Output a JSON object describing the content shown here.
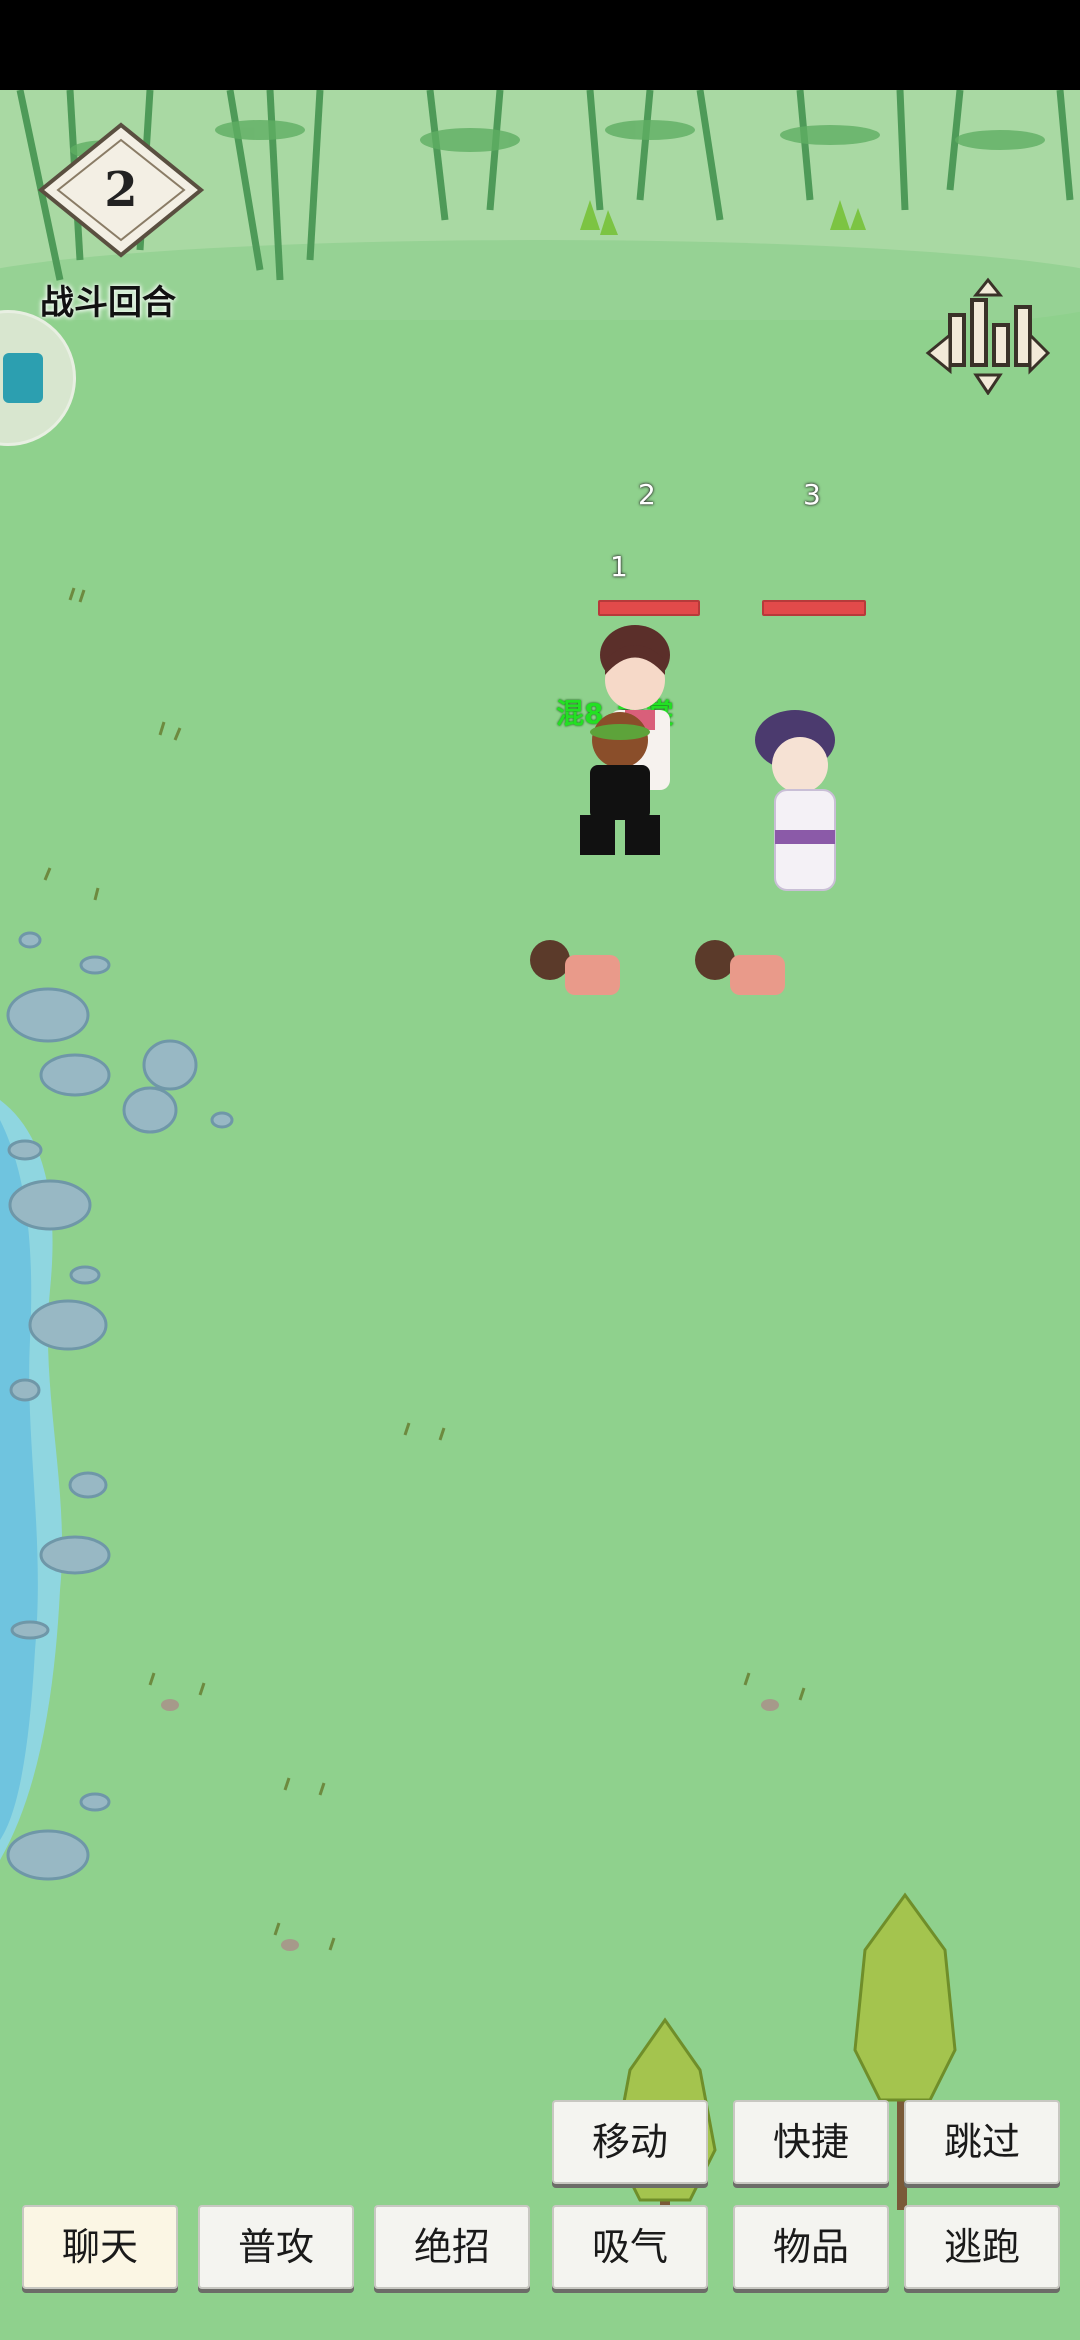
{
  "hud": {
    "round_number": "2",
    "round_label": "战斗回合"
  },
  "units": [
    {
      "slot": "1",
      "name": "混8_黄裳",
      "side": "player"
    },
    {
      "slot": "2",
      "name": "",
      "side": "enemy"
    },
    {
      "slot": "3",
      "name": "",
      "side": "enemy"
    }
  ],
  "actions": {
    "row1": [
      "移动",
      "快捷",
      "跳过"
    ],
    "row2": [
      "聊天",
      "普攻",
      "绝招",
      "吸气",
      "物品",
      "逃跑"
    ]
  },
  "colors": {
    "grass": "#8fd18d",
    "hp": "#e24a4a",
    "name_green": "#23e023",
    "water": "#8fd6e9"
  },
  "icons": [
    "stats-chart-icon",
    "round-diamond-icon",
    "chat-tab-icon"
  ]
}
